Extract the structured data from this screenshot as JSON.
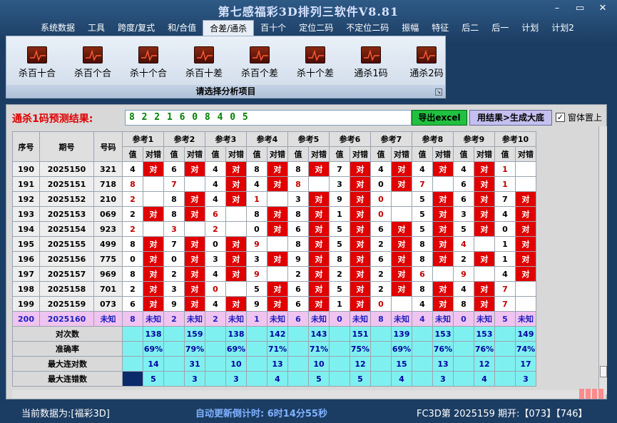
{
  "window": {
    "title": "第七感福彩3D排列三软件V8.81",
    "controls": [
      "–",
      "▭",
      "✕"
    ]
  },
  "menu": [
    "系统数据",
    "工具",
    "跨度/复式",
    "和/合值",
    "合差/通杀",
    "百十个",
    "定位二码",
    "不定位二码",
    "振幅",
    "特征",
    "后二",
    "后一",
    "计划",
    "计划2"
  ],
  "active_menu": 4,
  "ribbon": {
    "tools": [
      "杀百十合",
      "杀百个合",
      "杀十个合",
      "杀百十差",
      "杀百个差",
      "杀十个差",
      "通杀1码",
      "通杀2码"
    ],
    "caption": "请选择分析项目"
  },
  "prediction": {
    "label": "通杀1码预测结果:",
    "value": "8 2 2 1 6 0 8 4 0 5"
  },
  "buttons": {
    "export": "导出excel",
    "generate": "用结果>生成大底"
  },
  "checkbox": {
    "label": "窗体置上",
    "checked": true,
    "mark": "✓"
  },
  "table": {
    "headers": {
      "seq": "序号",
      "period": "期号",
      "number": "号码",
      "value": "值",
      "mark": "对错"
    },
    "refs": [
      "参考1",
      "参考2",
      "参考3",
      "参考4",
      "参考5",
      "参考6",
      "参考7",
      "参考8",
      "参考9",
      "参考10"
    ],
    "rows": [
      {
        "seq": "190",
        "period": "2025150",
        "num": "321",
        "cells": [
          [
            "4",
            "对"
          ],
          [
            "6",
            "对"
          ],
          [
            "4",
            "对"
          ],
          [
            "8",
            "对"
          ],
          [
            "8",
            "对"
          ],
          [
            "7",
            "对"
          ],
          [
            "4",
            "对"
          ],
          [
            "4",
            "对"
          ],
          [
            "4",
            "对"
          ],
          [
            "1",
            ""
          ]
        ]
      },
      {
        "seq": "191",
        "period": "2025151",
        "num": "718",
        "cells": [
          [
            "8",
            ""
          ],
          [
            "7",
            ""
          ],
          [
            "4",
            "对"
          ],
          [
            "4",
            "对"
          ],
          [
            "8",
            ""
          ],
          [
            "3",
            "对"
          ],
          [
            "0",
            "对"
          ],
          [
            "7",
            ""
          ],
          [
            "6",
            "对"
          ],
          [
            "1",
            ""
          ]
        ]
      },
      {
        "seq": "192",
        "period": "2025152",
        "num": "210",
        "cells": [
          [
            "2",
            ""
          ],
          [
            "8",
            "对"
          ],
          [
            "4",
            "对"
          ],
          [
            "1",
            ""
          ],
          [
            "3",
            "对"
          ],
          [
            "9",
            "对"
          ],
          [
            "0",
            ""
          ],
          [
            "5",
            "对"
          ],
          [
            "6",
            "对"
          ],
          [
            "7",
            "对"
          ]
        ]
      },
      {
        "seq": "193",
        "period": "2025153",
        "num": "069",
        "cells": [
          [
            "2",
            "对"
          ],
          [
            "8",
            "对"
          ],
          [
            "6",
            ""
          ],
          [
            "8",
            "对"
          ],
          [
            "8",
            "对"
          ],
          [
            "1",
            "对"
          ],
          [
            "0",
            ""
          ],
          [
            "5",
            "对"
          ],
          [
            "3",
            "对"
          ],
          [
            "4",
            "对"
          ]
        ]
      },
      {
        "seq": "194",
        "period": "2025154",
        "num": "923",
        "cells": [
          [
            "2",
            ""
          ],
          [
            "3",
            ""
          ],
          [
            "2",
            ""
          ],
          [
            "0",
            "对"
          ],
          [
            "6",
            "对"
          ],
          [
            "5",
            "对"
          ],
          [
            "6",
            "对"
          ],
          [
            "5",
            "对"
          ],
          [
            "5",
            "对"
          ],
          [
            "0",
            "对"
          ]
        ]
      },
      {
        "seq": "195",
        "period": "2025155",
        "num": "499",
        "cells": [
          [
            "8",
            "对"
          ],
          [
            "7",
            "对"
          ],
          [
            "0",
            "对"
          ],
          [
            "9",
            ""
          ],
          [
            "8",
            "对"
          ],
          [
            "5",
            "对"
          ],
          [
            "2",
            "对"
          ],
          [
            "8",
            "对"
          ],
          [
            "4",
            ""
          ],
          [
            "1",
            "对"
          ]
        ]
      },
      {
        "seq": "196",
        "period": "2025156",
        "num": "775",
        "cells": [
          [
            "0",
            "对"
          ],
          [
            "0",
            "对"
          ],
          [
            "3",
            "对"
          ],
          [
            "3",
            "对"
          ],
          [
            "9",
            "对"
          ],
          [
            "8",
            "对"
          ],
          [
            "6",
            "对"
          ],
          [
            "8",
            "对"
          ],
          [
            "2",
            "对"
          ],
          [
            "1",
            "对"
          ]
        ]
      },
      {
        "seq": "197",
        "period": "2025157",
        "num": "969",
        "cells": [
          [
            "8",
            "对"
          ],
          [
            "2",
            "对"
          ],
          [
            "4",
            "对"
          ],
          [
            "9",
            ""
          ],
          [
            "2",
            "对"
          ],
          [
            "2",
            "对"
          ],
          [
            "2",
            "对"
          ],
          [
            "6",
            ""
          ],
          [
            "9",
            ""
          ],
          [
            "4",
            "对"
          ]
        ]
      },
      {
        "seq": "198",
        "period": "2025158",
        "num": "701",
        "cells": [
          [
            "2",
            "对"
          ],
          [
            "3",
            "对"
          ],
          [
            "0",
            ""
          ],
          [
            "5",
            "对"
          ],
          [
            "6",
            "对"
          ],
          [
            "5",
            "对"
          ],
          [
            "2",
            "对"
          ],
          [
            "8",
            "对"
          ],
          [
            "4",
            "对"
          ],
          [
            "7",
            ""
          ]
        ]
      },
      {
        "seq": "199",
        "period": "2025159",
        "num": "073",
        "cells": [
          [
            "6",
            "对"
          ],
          [
            "9",
            "对"
          ],
          [
            "4",
            "对"
          ],
          [
            "9",
            "对"
          ],
          [
            "6",
            "对"
          ],
          [
            "1",
            "对"
          ],
          [
            "0",
            ""
          ],
          [
            "4",
            "对"
          ],
          [
            "8",
            "对"
          ],
          [
            "7",
            ""
          ]
        ]
      }
    ],
    "unknown_row": {
      "seq": "200",
      "period": "2025160",
      "num": "未知",
      "values": [
        "8",
        "2",
        "2",
        "1",
        "6",
        "0",
        "8",
        "4",
        "0",
        "5"
      ],
      "mark": "未知"
    },
    "stats": [
      {
        "label": "对次数",
        "values": [
          "138",
          "159",
          "138",
          "142",
          "143",
          "151",
          "139",
          "153",
          "153",
          "149"
        ]
      },
      {
        "label": "准确率",
        "values": [
          "69%",
          "79%",
          "69%",
          "71%",
          "71%",
          "75%",
          "69%",
          "76%",
          "76%",
          "74%"
        ]
      },
      {
        "label": "最大连对数",
        "values": [
          "14",
          "31",
          "10",
          "13",
          "10",
          "12",
          "15",
          "13",
          "12",
          "17"
        ]
      },
      {
        "label": "最大连错数",
        "values": [
          "5",
          "3",
          "3",
          "4",
          "5",
          "5",
          "4",
          "3",
          "4",
          "3"
        ]
      }
    ]
  },
  "status": {
    "current_data": "当前数据为:[福彩3D]",
    "countdown": "自动更新倒计时: 6时14分55秒",
    "draw": "FC3D第 2025159 期开:【073】【746】"
  },
  "colors": {
    "red": "#e00000",
    "cyan": "#7ff0f0",
    "pink": "#f0c4f0",
    "green": "#20c040"
  }
}
